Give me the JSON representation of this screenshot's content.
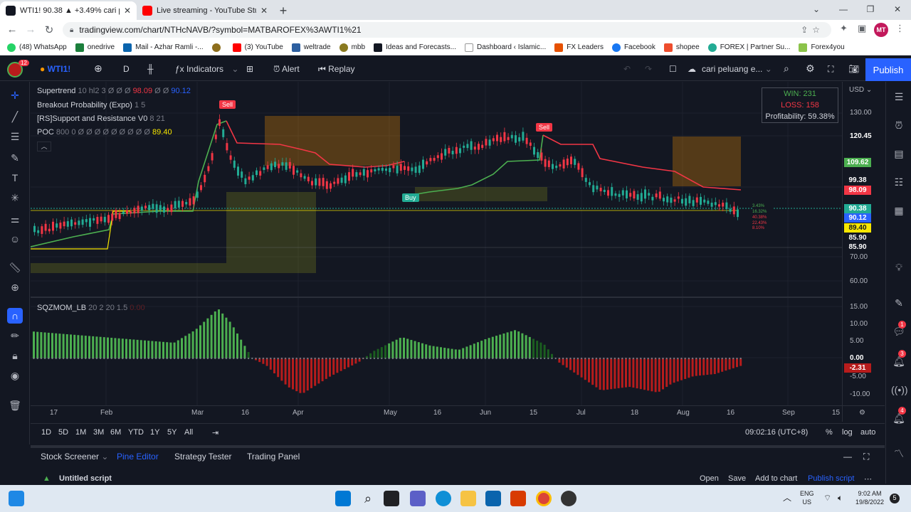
{
  "browser": {
    "tabs": [
      {
        "title": "WTI1! 90.38 ▲ +3.49% cari peluang",
        "active": true
      },
      {
        "title": "Live streaming - YouTube Studio",
        "active": false
      }
    ],
    "url": "tradingview.com/chart/NTHcNAVB/?symbol=MATBAROFEX%3AWTI1%21",
    "bookmarks": [
      "(48) WhatsApp",
      "onedrive",
      "Mail - Azhar Ramli -...",
      "(3) YouTube",
      "weltrade",
      "mbb",
      "Ideas and Forecasts...",
      "Dashboard ‹ Islamic...",
      "FX Leaders",
      "Facebook",
      "shopee",
      "FOREX | Partner Su...",
      "Forex4you"
    ],
    "avatar_initials": "MT"
  },
  "toolbar": {
    "notif_count": "12",
    "symbol": "WTI1!",
    "interval": "D",
    "indicators": "Indicators",
    "alert": "Alert",
    "replay": "Replay",
    "layout_name": "cari peluang e...",
    "publish": "Publish"
  },
  "legend": {
    "supertrend": {
      "name": "Supertrend",
      "params": "10 hl2 3",
      "values": "Ø Ø Ø",
      "v1": "98.09",
      "v2": "Ø Ø",
      "v3": "90.12"
    },
    "breakout": {
      "name": "Breakout Probability (Expo)",
      "params": "1 5"
    },
    "sr": {
      "name": "[RS]Support and Resistance V0",
      "params": "8 21"
    },
    "poc": {
      "name": "POC",
      "params": "800 0",
      "values": "Ø Ø Ø Ø Ø Ø Ø Ø Ø",
      "v": "89.40"
    }
  },
  "stats": {
    "win": "WIN: 231",
    "loss": "LOSS: 158",
    "profitability": "Profitability: 59.38%"
  },
  "signals": {
    "sell": "Sell",
    "buy": "Buy"
  },
  "price_scale": {
    "currency": "USD",
    "labels": [
      "130.00",
      "120.45",
      "70.00",
      "60.00"
    ],
    "tags": [
      {
        "text": "109.62",
        "bg": "#4caf50",
        "fg": "#ffffff"
      },
      {
        "text": "99.38",
        "bg": "#131722",
        "fg": "#ffffff"
      },
      {
        "text": "98.09",
        "bg": "#f23645",
        "fg": "#ffffff"
      },
      {
        "text": "90.38",
        "bg": "#22ab94",
        "fg": "#ffffff"
      },
      {
        "text": "90.12",
        "bg": "#2962ff",
        "fg": "#ffffff"
      },
      {
        "text": "89.40",
        "bg": "#f7e600",
        "fg": "#131722"
      },
      {
        "text": "85.90",
        "bg": "#131722",
        "fg": "#ffffff"
      },
      {
        "text": "85.90",
        "bg": "#131722",
        "fg": "#ffffff"
      }
    ],
    "osc_labels": [
      "15.00",
      "10.00",
      "5.00",
      "0.00",
      "-2.31",
      "-5.00",
      "-10.00"
    ]
  },
  "oscillator": {
    "name": "SQZMOM_LB",
    "params": "20 2 20 1.5",
    "value": "0.00"
  },
  "time_axis": [
    "17",
    "Feb",
    "Mar",
    "16",
    "Apr",
    "May",
    "16",
    "Jun",
    "15",
    "Jul",
    "18",
    "Aug",
    "16",
    "Sep",
    "15"
  ],
  "ranges": [
    "1D",
    "5D",
    "1M",
    "3M",
    "6M",
    "YTD",
    "1Y",
    "5Y",
    "All"
  ],
  "clock": "09:02:16 (UTC+8)",
  "scale_opts": [
    "%",
    "log",
    "auto"
  ],
  "bottom_tabs": [
    "Stock Screener",
    "Pine Editor",
    "Strategy Tester",
    "Trading Panel"
  ],
  "script": {
    "name": "Untitled script",
    "open": "Open",
    "save": "Save",
    "add": "Add to chart",
    "publish": "Publish script"
  },
  "taskbar": {
    "lang1": "ENG",
    "lang2": "US",
    "time": "9:02 AM",
    "date": "19/8/2022",
    "notif": "5"
  },
  "colors": {
    "bull": "#22ab94",
    "bear": "#f23645",
    "accent": "#2962ff"
  }
}
